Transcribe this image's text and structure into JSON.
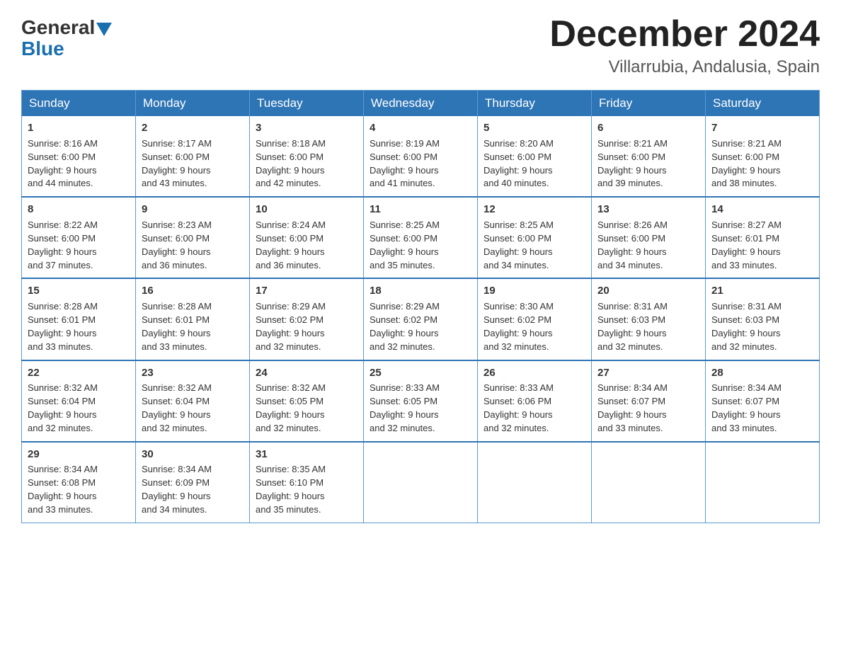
{
  "logo": {
    "general": "General",
    "blue": "Blue"
  },
  "title": "December 2024",
  "location": "Villarrubia, Andalusia, Spain",
  "weekdays": [
    "Sunday",
    "Monday",
    "Tuesday",
    "Wednesday",
    "Thursday",
    "Friday",
    "Saturday"
  ],
  "weeks": [
    [
      {
        "day": "1",
        "sunrise": "8:16 AM",
        "sunset": "6:00 PM",
        "daylight": "9 hours and 44 minutes."
      },
      {
        "day": "2",
        "sunrise": "8:17 AM",
        "sunset": "6:00 PM",
        "daylight": "9 hours and 43 minutes."
      },
      {
        "day": "3",
        "sunrise": "8:18 AM",
        "sunset": "6:00 PM",
        "daylight": "9 hours and 42 minutes."
      },
      {
        "day": "4",
        "sunrise": "8:19 AM",
        "sunset": "6:00 PM",
        "daylight": "9 hours and 41 minutes."
      },
      {
        "day": "5",
        "sunrise": "8:20 AM",
        "sunset": "6:00 PM",
        "daylight": "9 hours and 40 minutes."
      },
      {
        "day": "6",
        "sunrise": "8:21 AM",
        "sunset": "6:00 PM",
        "daylight": "9 hours and 39 minutes."
      },
      {
        "day": "7",
        "sunrise": "8:21 AM",
        "sunset": "6:00 PM",
        "daylight": "9 hours and 38 minutes."
      }
    ],
    [
      {
        "day": "8",
        "sunrise": "8:22 AM",
        "sunset": "6:00 PM",
        "daylight": "9 hours and 37 minutes."
      },
      {
        "day": "9",
        "sunrise": "8:23 AM",
        "sunset": "6:00 PM",
        "daylight": "9 hours and 36 minutes."
      },
      {
        "day": "10",
        "sunrise": "8:24 AM",
        "sunset": "6:00 PM",
        "daylight": "9 hours and 36 minutes."
      },
      {
        "day": "11",
        "sunrise": "8:25 AM",
        "sunset": "6:00 PM",
        "daylight": "9 hours and 35 minutes."
      },
      {
        "day": "12",
        "sunrise": "8:25 AM",
        "sunset": "6:00 PM",
        "daylight": "9 hours and 34 minutes."
      },
      {
        "day": "13",
        "sunrise": "8:26 AM",
        "sunset": "6:00 PM",
        "daylight": "9 hours and 34 minutes."
      },
      {
        "day": "14",
        "sunrise": "8:27 AM",
        "sunset": "6:01 PM",
        "daylight": "9 hours and 33 minutes."
      }
    ],
    [
      {
        "day": "15",
        "sunrise": "8:28 AM",
        "sunset": "6:01 PM",
        "daylight": "9 hours and 33 minutes."
      },
      {
        "day": "16",
        "sunrise": "8:28 AM",
        "sunset": "6:01 PM",
        "daylight": "9 hours and 33 minutes."
      },
      {
        "day": "17",
        "sunrise": "8:29 AM",
        "sunset": "6:02 PM",
        "daylight": "9 hours and 32 minutes."
      },
      {
        "day": "18",
        "sunrise": "8:29 AM",
        "sunset": "6:02 PM",
        "daylight": "9 hours and 32 minutes."
      },
      {
        "day": "19",
        "sunrise": "8:30 AM",
        "sunset": "6:02 PM",
        "daylight": "9 hours and 32 minutes."
      },
      {
        "day": "20",
        "sunrise": "8:31 AM",
        "sunset": "6:03 PM",
        "daylight": "9 hours and 32 minutes."
      },
      {
        "day": "21",
        "sunrise": "8:31 AM",
        "sunset": "6:03 PM",
        "daylight": "9 hours and 32 minutes."
      }
    ],
    [
      {
        "day": "22",
        "sunrise": "8:32 AM",
        "sunset": "6:04 PM",
        "daylight": "9 hours and 32 minutes."
      },
      {
        "day": "23",
        "sunrise": "8:32 AM",
        "sunset": "6:04 PM",
        "daylight": "9 hours and 32 minutes."
      },
      {
        "day": "24",
        "sunrise": "8:32 AM",
        "sunset": "6:05 PM",
        "daylight": "9 hours and 32 minutes."
      },
      {
        "day": "25",
        "sunrise": "8:33 AM",
        "sunset": "6:05 PM",
        "daylight": "9 hours and 32 minutes."
      },
      {
        "day": "26",
        "sunrise": "8:33 AM",
        "sunset": "6:06 PM",
        "daylight": "9 hours and 32 minutes."
      },
      {
        "day": "27",
        "sunrise": "8:34 AM",
        "sunset": "6:07 PM",
        "daylight": "9 hours and 33 minutes."
      },
      {
        "day": "28",
        "sunrise": "8:34 AM",
        "sunset": "6:07 PM",
        "daylight": "9 hours and 33 minutes."
      }
    ],
    [
      {
        "day": "29",
        "sunrise": "8:34 AM",
        "sunset": "6:08 PM",
        "daylight": "9 hours and 33 minutes."
      },
      {
        "day": "30",
        "sunrise": "8:34 AM",
        "sunset": "6:09 PM",
        "daylight": "9 hours and 34 minutes."
      },
      {
        "day": "31",
        "sunrise": "8:35 AM",
        "sunset": "6:10 PM",
        "daylight": "9 hours and 35 minutes."
      },
      null,
      null,
      null,
      null
    ]
  ],
  "labels": {
    "sunrise": "Sunrise: ",
    "sunset": "Sunset: ",
    "daylight": "Daylight: "
  }
}
